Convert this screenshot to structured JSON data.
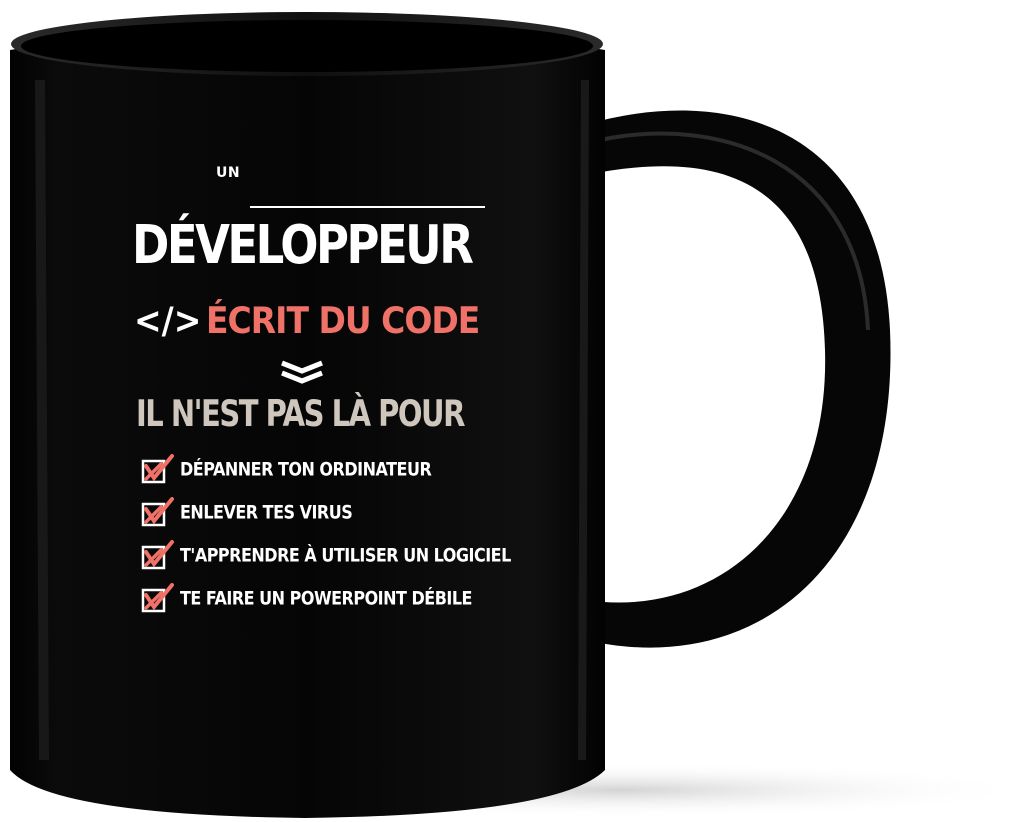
{
  "product": {
    "print": {
      "intro": "UN",
      "title": "DÉVELOPPEUR",
      "code_tag": "</>",
      "subtitle": "ÉCRIT DU CODE",
      "statement": "IL N'EST PAS LÀ POUR",
      "checklist": [
        "DÉPANNER TON ORDINATEUR",
        "ENLEVER TES VIRUS",
        "T'APPRENDRE À UTILISER UN LOGICIEL",
        "TE FAIRE UN POWERPOINT DÉBILE"
      ]
    },
    "colors": {
      "mug": "#050505",
      "text": "#ffffff",
      "accent": "#ef7167",
      "muted": "#cfc7be",
      "background": "#ffffff"
    },
    "icons": [
      "chevron-double-down-icon",
      "checked-box-icon"
    ]
  }
}
